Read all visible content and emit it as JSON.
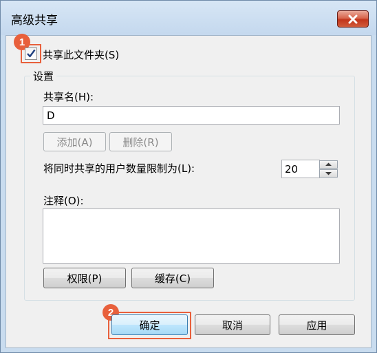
{
  "window": {
    "title": "高级共享"
  },
  "share_checkbox": {
    "label": "共享此文件夹(S)",
    "checked": true
  },
  "settings": {
    "group_label": "设置",
    "share_name_label": "共享名(H):",
    "share_name_value": "D",
    "add_button": "添加(A)",
    "remove_button": "删除(R)",
    "user_limit_label": "将同时共享的用户数量限制为(L):",
    "user_limit_value": "20",
    "comment_label": "注释(O):",
    "comment_value": "",
    "permissions_button": "权限(P)",
    "caching_button": "缓存(C)"
  },
  "footer": {
    "ok_button": "确定",
    "cancel_button": "取消",
    "apply_button": "应用"
  },
  "annotations": {
    "step1": "1",
    "step2": "2",
    "color": "#e8603c"
  }
}
